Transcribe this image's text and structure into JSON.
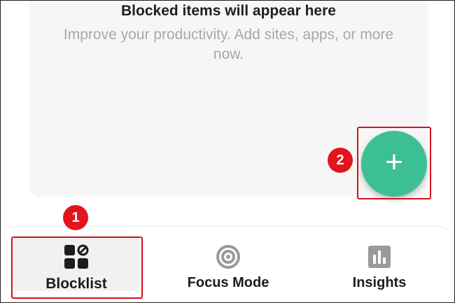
{
  "empty_state": {
    "title": "Blocked items will appear here",
    "subtitle": "Improve your productivity. Add sites, apps, or more now."
  },
  "fab": {
    "label": "+",
    "color": "#3dbf95"
  },
  "annotations": {
    "badge_1": "1",
    "badge_2": "2",
    "highlight_color": "#d3121d"
  },
  "bottom_nav": {
    "items": [
      {
        "label": "Blocklist",
        "icon": "blocklist-icon",
        "selected": true
      },
      {
        "label": "Focus Mode",
        "icon": "target-icon",
        "selected": false
      },
      {
        "label": "Insights",
        "icon": "bar-chart-icon",
        "selected": false
      }
    ]
  }
}
